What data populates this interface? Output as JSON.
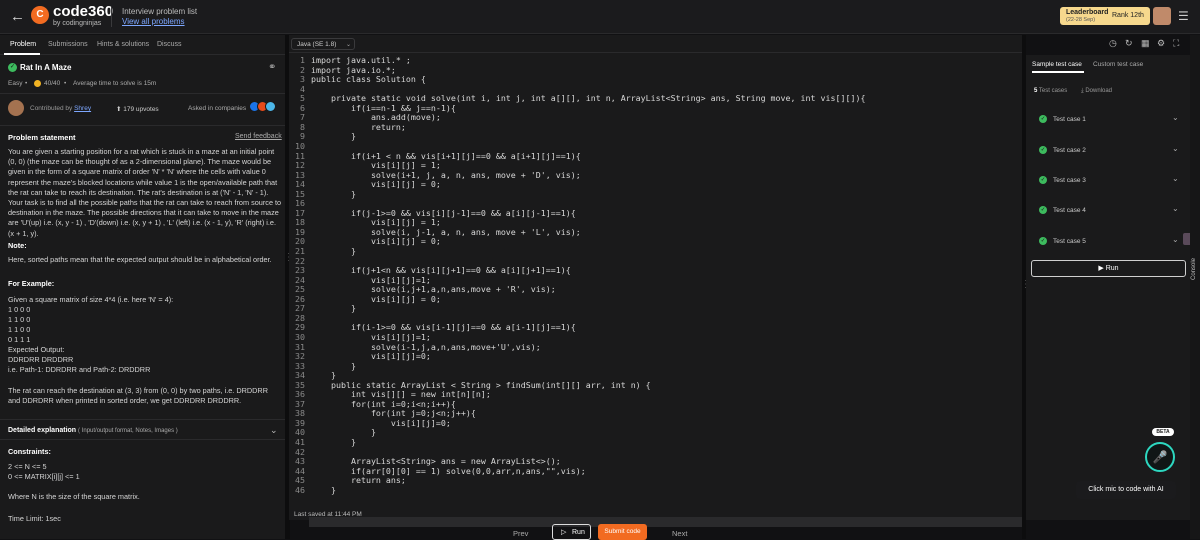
{
  "header": {
    "brand": "code360",
    "brand_sub": "by codingninjas",
    "crumb_title": "Interview problem list",
    "crumb_link": "View all problems",
    "leaderboard_label": "Leaderboard",
    "leaderboard_dates": "(22-28 Sep)",
    "rank_label": "Rank 12th"
  },
  "left_tabs": [
    "Problem",
    "Submissions",
    "Hints & solutions",
    "Discuss"
  ],
  "problem": {
    "title": "Rat In A Maze",
    "difficulty": "Easy",
    "score": "40/40",
    "avg_time": "Average time to solve is 15m",
    "contributed_label": "Contributed by",
    "contributor": "Shrey",
    "upvotes": "179 upvotes",
    "asked_in": "Asked in companies",
    "statement_heading": "Problem statement",
    "feedback": "Send feedback",
    "statement": "You are given a starting position for a rat which is stuck in a maze at an initial point (0, 0) (the maze can be thought of as a 2-dimensional plane). The maze would be given in the form of a square matrix of order 'N' * 'N' where the cells with value 0 represent the maze's blocked locations while value 1 is the open/available path that the rat can take to reach its destination. The rat's destination is at ('N' - 1, 'N' - 1). Your task is to find all the possible paths that the rat can take to reach from source to destination in the maze. The possible directions that it can take to move in the maze are 'U'(up) i.e. (x, y - 1) , 'D'(down) i.e. (x, y + 1) , 'L' (left) i.e. (x - 1, y), 'R' (right) i.e. (x + 1, y).",
    "note_label": "Note:",
    "note": "Here, sorted paths mean that the expected output should be in alphabetical order.",
    "example_label": "For Example:",
    "example_lines": [
      "Given a square matrix of size 4*4 (i.e. here 'N' = 4):",
      "1 0 0 0",
      "1 1 0 0",
      "1 1 0 0",
      "0 1 1 1",
      "Expected Output:",
      "DDRDRR DRDDRR",
      "i.e. Path-1: DDRDRR and Path-2: DRDDRR"
    ],
    "explain": "The rat can reach the destination at (3, 3) from (0, 0) by two paths, i.e. DRDDRR and DDRDRR when printed in sorted order, we get DDRDRR DRDDRR.",
    "detail_label": "Detailed explanation",
    "detail_sub": "( Input/output format, Notes, Images )",
    "constraints_label": "Constraints:",
    "constraints": [
      "2 <= N <= 5",
      "0 <= MATRIX[i][j] <= 1"
    ],
    "where": "Where N is the size of the square matrix.",
    "time_limit": "Time Limit: 1sec"
  },
  "editor": {
    "language": "Java (SE 1.8)",
    "last_saved": "Last saved at 11:44 PM",
    "lines": [
      "import java.util.* ;",
      "import java.io.*;",
      "public class Solution {",
      "",
      "    private static void solve(int i, int j, int a[][], int n, ArrayList<String> ans, String move, int vis[][]){",
      "        if(i==n-1 && j==n-1){",
      "            ans.add(move);",
      "            return;",
      "        }",
      "",
      "        if(i+1 < n && vis[i+1][j]==0 && a[i+1][j]==1){",
      "            vis[i][j] = 1;",
      "            solve(i+1, j, a, n, ans, move + 'D', vis);",
      "            vis[i][j] = 0;",
      "        }",
      "",
      "        if(j-1>=0 && vis[i][j-1]==0 && a[i][j-1]==1){",
      "            vis[i][j] = 1;",
      "            solve(i, j-1, a, n, ans, move + 'L', vis);",
      "            vis[i][j] = 0;",
      "        }",
      "",
      "        if(j+1<n && vis[i][j+1]==0 && a[i][j+1]==1){",
      "            vis[i][j]=1;",
      "            solve(i,j+1,a,n,ans,move + 'R', vis);",
      "            vis[i][j] = 0;",
      "        }",
      "",
      "        if(i-1>=0 && vis[i-1][j]==0 && a[i-1][j]==1){",
      "            vis[i][j]=1;",
      "            solve(i-1,j,a,n,ans,move+'U',vis);",
      "            vis[i][j]=0;",
      "        }",
      "    }",
      "    public static ArrayList < String > findSum(int[][] arr, int n) {",
      "        int vis[][] = new int[n][n];",
      "        for(int i=0;i<n;i++){",
      "            for(int j=0;j<n;j++){",
      "                vis[i][j]=0;",
      "            }",
      "        }",
      "",
      "        ArrayList<String> ans = new ArrayList<>();",
      "        if(arr[0][0] == 1) solve(0,0,arr,n,ans,\"\",vis);",
      "        return ans;",
      "    }"
    ]
  },
  "footer": {
    "prev": "Prev",
    "run": "Run",
    "submit": "Submit code",
    "next": "Next"
  },
  "testpanel": {
    "tabs": [
      "Sample test case",
      "Custom test case"
    ],
    "count": "5",
    "count_label": "Test cases",
    "download": "Download",
    "cases": [
      "Test case 1",
      "Test case 2",
      "Test case 3",
      "Test case 4",
      "Test case 5"
    ],
    "run": "Run",
    "beta": "BETA",
    "mic_tip": "Click mic to code with AI",
    "console": "Console"
  },
  "colors": {
    "accent": "#f26b21",
    "success": "#3dbb5e",
    "mic_ring": "#2dd7c0"
  }
}
